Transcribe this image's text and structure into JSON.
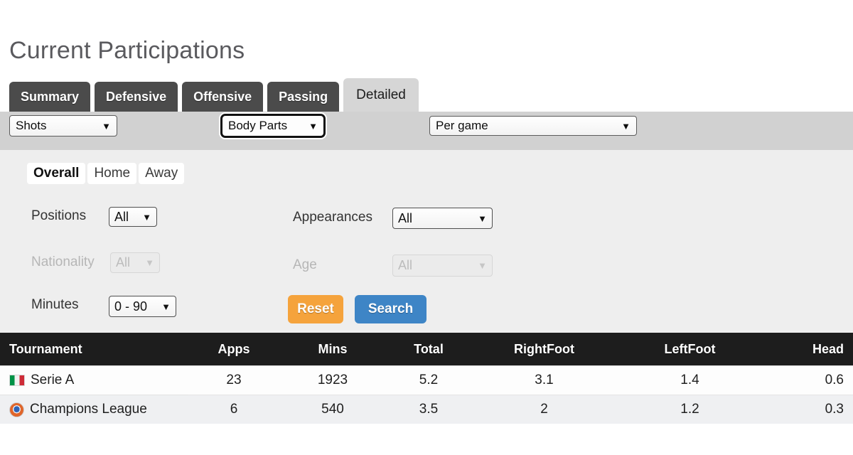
{
  "page": {
    "title": "Current Participations"
  },
  "tabs": [
    {
      "label": "Summary",
      "active": false
    },
    {
      "label": "Defensive",
      "active": false
    },
    {
      "label": "Offensive",
      "active": false
    },
    {
      "label": "Passing",
      "active": false
    },
    {
      "label": "Detailed",
      "active": true
    }
  ],
  "toolbar": {
    "stat_category": "Shots",
    "stat_subcategory": "Body Parts",
    "aggregation": "Per game"
  },
  "filters": {
    "venue_segments": [
      {
        "label": "Overall",
        "active": true
      },
      {
        "label": "Home",
        "active": false
      },
      {
        "label": "Away",
        "active": false
      }
    ],
    "positions_label": "Positions",
    "positions_value": "All",
    "nationality_label": "Nationality",
    "nationality_value": "All",
    "minutes_label": "Minutes",
    "minutes_value": "0 - 90",
    "appearances_label": "Appearances",
    "appearances_value": "All",
    "age_label": "Age",
    "age_value": "All",
    "reset_label": "Reset",
    "search_label": "Search"
  },
  "table": {
    "headers": [
      "Tournament",
      "Apps",
      "Mins",
      "Total",
      "RightFoot",
      "LeftFoot",
      "Head"
    ],
    "rows": [
      {
        "icon": "italy-flag-icon",
        "tournament": "Serie A",
        "apps": "23",
        "mins": "1923",
        "total": "5.2",
        "right_foot": "3.1",
        "left_foot": "1.4",
        "head": "0.6"
      },
      {
        "icon": "champions-league-badge-icon",
        "tournament": "Champions League",
        "apps": "6",
        "mins": "540",
        "total": "3.5",
        "right_foot": "2",
        "left_foot": "1.2",
        "head": "0.3"
      }
    ]
  },
  "colors": {
    "tab_inactive": "#4b4b4b",
    "tab_active": "#d6d6d6",
    "toolbar_band": "#d1d1d1",
    "filter_panel": "#eeeeee",
    "table_header": "#1d1d1d",
    "reset_button": "#f5a33c",
    "search_button": "#3e85c6"
  },
  "icons": {
    "caret_down": "⌄"
  }
}
